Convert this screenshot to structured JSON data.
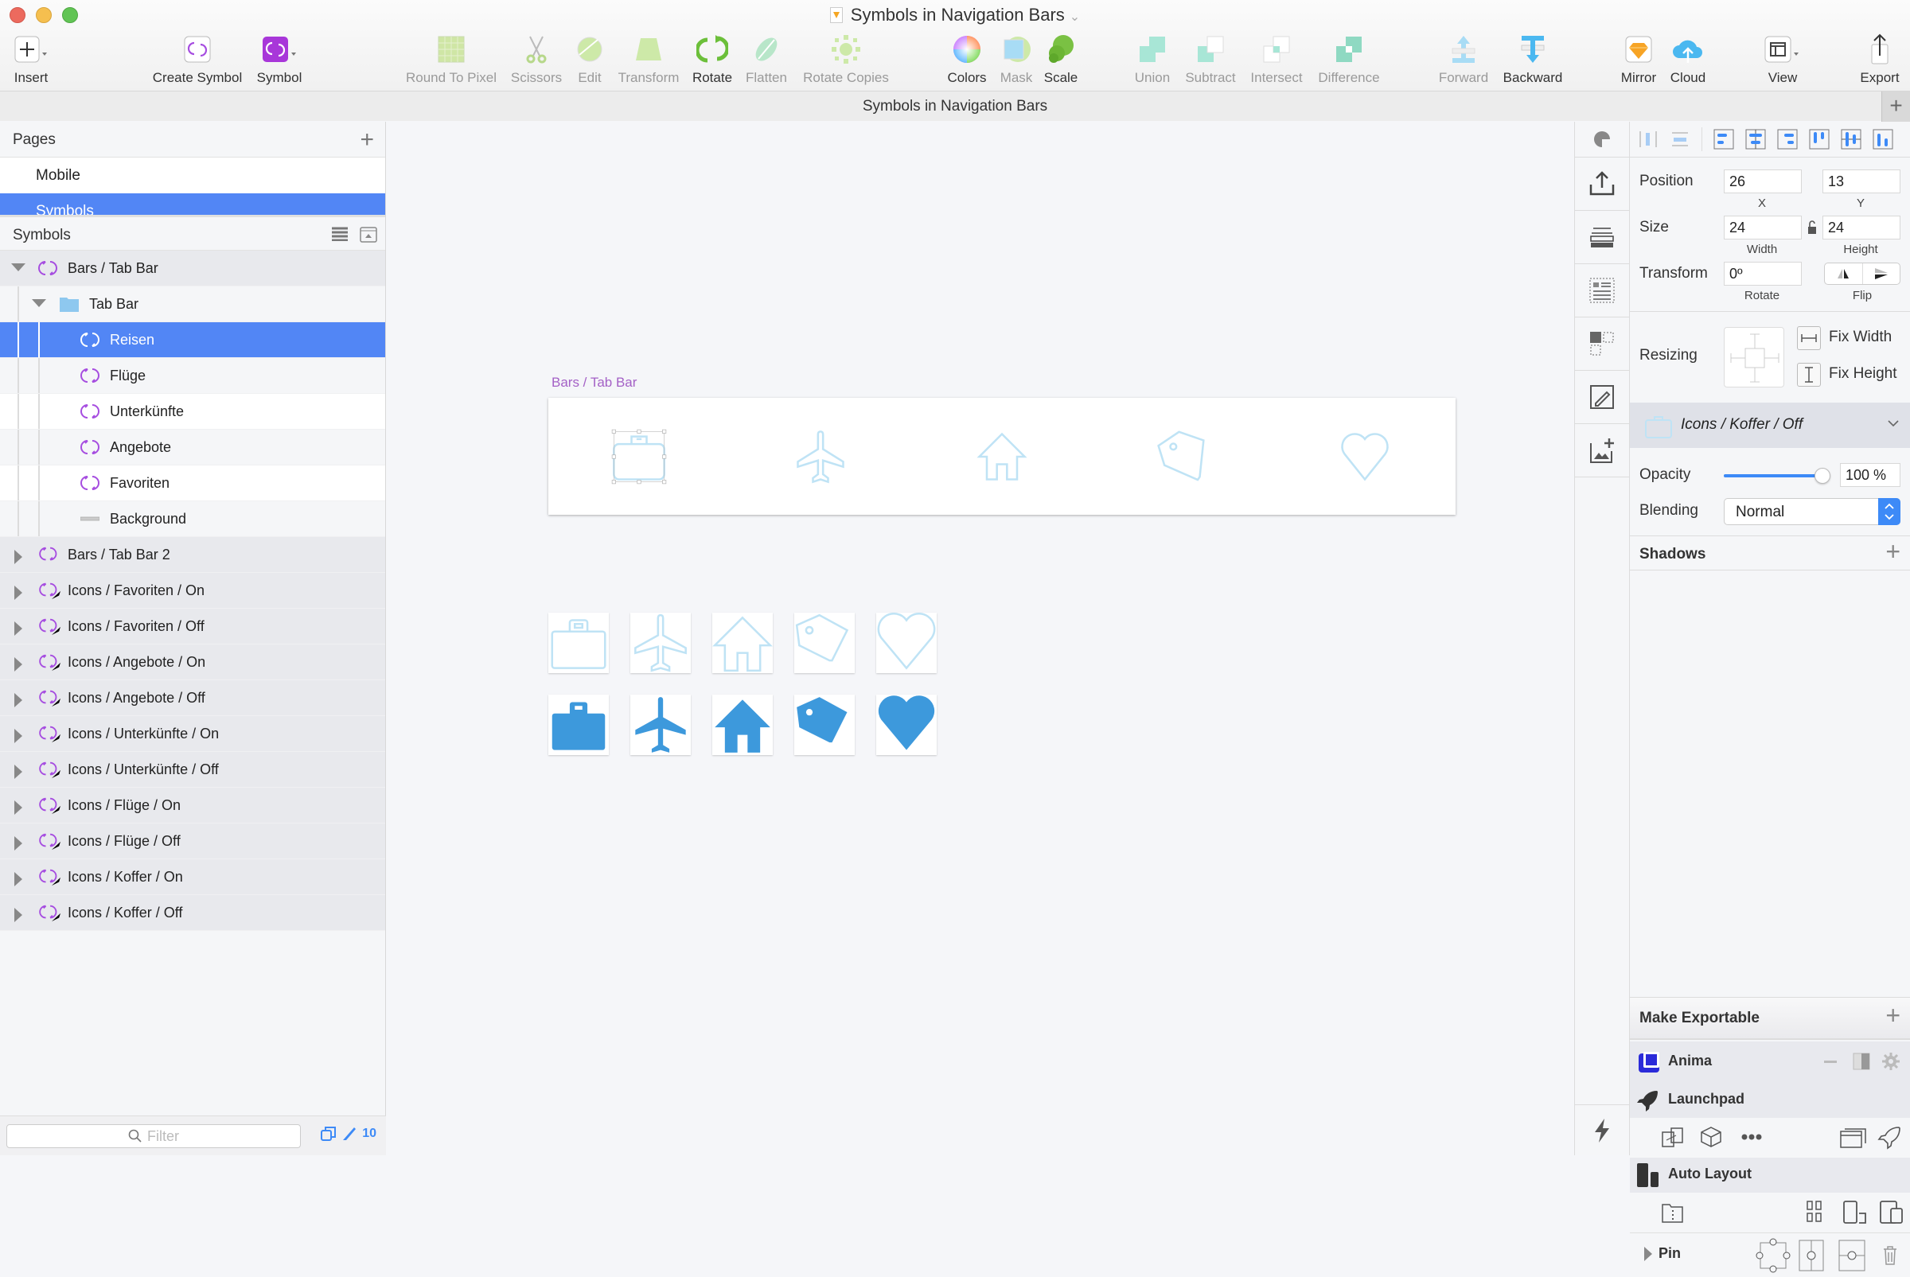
{
  "window": {
    "title": "Symbols in Navigation Bars",
    "document_tab": "Symbols in Navigation Bars"
  },
  "toolbar": [
    {
      "id": "insert",
      "label": "Insert",
      "enabled": true,
      "icon": "plus-icon"
    },
    {
      "id": "create-symbol",
      "label": "Create Symbol",
      "enabled": true,
      "icon": "symbol-icon"
    },
    {
      "id": "symbol",
      "label": "Symbol",
      "enabled": true,
      "icon": "symbol-filled-icon"
    },
    {
      "id": "round-to-pixel",
      "label": "Round To Pixel",
      "enabled": false,
      "icon": "grid-icon"
    },
    {
      "id": "scissors",
      "label": "Scissors",
      "enabled": false,
      "icon": "scissors-icon"
    },
    {
      "id": "edit",
      "label": "Edit",
      "enabled": false,
      "icon": "edit-icon"
    },
    {
      "id": "transform",
      "label": "Transform",
      "enabled": false,
      "icon": "transform-icon"
    },
    {
      "id": "rotate",
      "label": "Rotate",
      "enabled": true,
      "icon": "rotate-icon"
    },
    {
      "id": "flatten",
      "label": "Flatten",
      "enabled": false,
      "icon": "flatten-icon"
    },
    {
      "id": "rotate-copies",
      "label": "Rotate Copies",
      "enabled": false,
      "icon": "rotate-copies-icon"
    },
    {
      "id": "colors",
      "label": "Colors",
      "enabled": true,
      "icon": "color-wheel-icon"
    },
    {
      "id": "mask",
      "label": "Mask",
      "enabled": false,
      "icon": "mask-icon"
    },
    {
      "id": "scale",
      "label": "Scale",
      "enabled": true,
      "icon": "scale-icon"
    },
    {
      "id": "union",
      "label": "Union",
      "enabled": false,
      "icon": "union-icon"
    },
    {
      "id": "subtract",
      "label": "Subtract",
      "enabled": false,
      "icon": "subtract-icon"
    },
    {
      "id": "intersect",
      "label": "Intersect",
      "enabled": false,
      "icon": "intersect-icon"
    },
    {
      "id": "difference",
      "label": "Difference",
      "enabled": false,
      "icon": "difference-icon"
    },
    {
      "id": "forward",
      "label": "Forward",
      "enabled": false,
      "icon": "forward-icon"
    },
    {
      "id": "backward",
      "label": "Backward",
      "enabled": true,
      "icon": "backward-icon"
    },
    {
      "id": "mirror",
      "label": "Mirror",
      "enabled": true,
      "icon": "mirror-icon"
    },
    {
      "id": "cloud",
      "label": "Cloud",
      "enabled": true,
      "icon": "cloud-icon"
    },
    {
      "id": "view",
      "label": "View",
      "enabled": true,
      "icon": "view-icon"
    },
    {
      "id": "export",
      "label": "Export",
      "enabled": true,
      "icon": "export-icon"
    }
  ],
  "pages": {
    "header": "Pages",
    "items": [
      {
        "label": "Mobile",
        "selected": false
      },
      {
        "label": "Symbols",
        "selected": true
      }
    ]
  },
  "layers": {
    "header": "Symbols",
    "items": [
      {
        "label": "Bars / Tab Bar",
        "type": "symbol",
        "expanded": true,
        "depth": 0
      },
      {
        "label": "Tab Bar",
        "type": "folder",
        "expanded": true,
        "depth": 1
      },
      {
        "label": "Reisen",
        "type": "symbol",
        "depth": 2,
        "selected": true
      },
      {
        "label": "Flüge",
        "type": "symbol",
        "depth": 2
      },
      {
        "label": "Unterkünfte",
        "type": "symbol",
        "depth": 2
      },
      {
        "label": "Angebote",
        "type": "symbol",
        "depth": 2
      },
      {
        "label": "Favoriten",
        "type": "symbol",
        "depth": 2
      },
      {
        "label": "Background",
        "type": "rect",
        "depth": 2
      },
      {
        "label": "Bars / Tab Bar 2",
        "type": "symbol",
        "expanded": false,
        "depth": 0
      },
      {
        "label": "Icons / Favoriten / On",
        "type": "symbol-vector",
        "expanded": false,
        "depth": 0
      },
      {
        "label": "Icons / Favoriten / Off",
        "type": "symbol-vector",
        "expanded": false,
        "depth": 0
      },
      {
        "label": "Icons / Angebote / On",
        "type": "symbol-vector",
        "expanded": false,
        "depth": 0
      },
      {
        "label": "Icons / Angebote / Off",
        "type": "symbol-vector",
        "expanded": false,
        "depth": 0
      },
      {
        "label": "Icons / Unterkünfte / On",
        "type": "symbol-vector",
        "expanded": false,
        "depth": 0
      },
      {
        "label": "Icons / Unterkünfte / Off",
        "type": "symbol-vector",
        "expanded": false,
        "depth": 0
      },
      {
        "label": "Icons / Flüge / On",
        "type": "symbol-vector",
        "expanded": false,
        "depth": 0
      },
      {
        "label": "Icons / Flüge / Off",
        "type": "symbol-vector",
        "expanded": false,
        "depth": 0
      },
      {
        "label": "Icons / Koffer / On",
        "type": "symbol-vector",
        "expanded": false,
        "depth": 0
      },
      {
        "label": "Icons / Koffer / Off",
        "type": "symbol-vector",
        "expanded": false,
        "depth": 0
      }
    ],
    "filter_placeholder": "Filter",
    "count": "10"
  },
  "canvas": {
    "artboard_label": "Bars / Tab Bar",
    "tab_icons": [
      "suitcase-icon",
      "airplane-icon",
      "house-icon",
      "tag-icon",
      "heart-icon"
    ],
    "grid_off": [
      "suitcase-icon",
      "airplane-icon",
      "house-icon",
      "tag-icon",
      "heart-icon"
    ],
    "grid_on": [
      "suitcase-icon",
      "airplane-icon",
      "house-icon",
      "tag-icon",
      "heart-icon"
    ],
    "colors": {
      "off": "#bfe3f5",
      "on": "#3d99dc",
      "label": "#a461c6",
      "selection": "#5286f5"
    }
  },
  "inspector": {
    "position_label": "Position",
    "x": "26",
    "x_label": "X",
    "y": "13",
    "y_label": "Y",
    "size_label": "Size",
    "width": "24",
    "width_label": "Width",
    "height": "24",
    "height_label": "Height",
    "transform_label": "Transform",
    "rotate": "0º",
    "rotate_label": "Rotate",
    "flip_label": "Flip",
    "resizing_label": "Resizing",
    "fix_width": "Fix Width",
    "fix_height": "Fix Height",
    "symbol_name": "Icons / Koffer / Off",
    "opacity_label": "Opacity",
    "opacity_value": "100 %",
    "opacity_fraction": 1.0,
    "blending_label": "Blending",
    "blending_value": "Normal",
    "shadows_label": "Shadows",
    "make_exportable": "Make Exportable",
    "plugins": {
      "anima": "Anima",
      "launchpad": "Launchpad",
      "auto_layout": "Auto Layout",
      "pin": "Pin"
    }
  }
}
